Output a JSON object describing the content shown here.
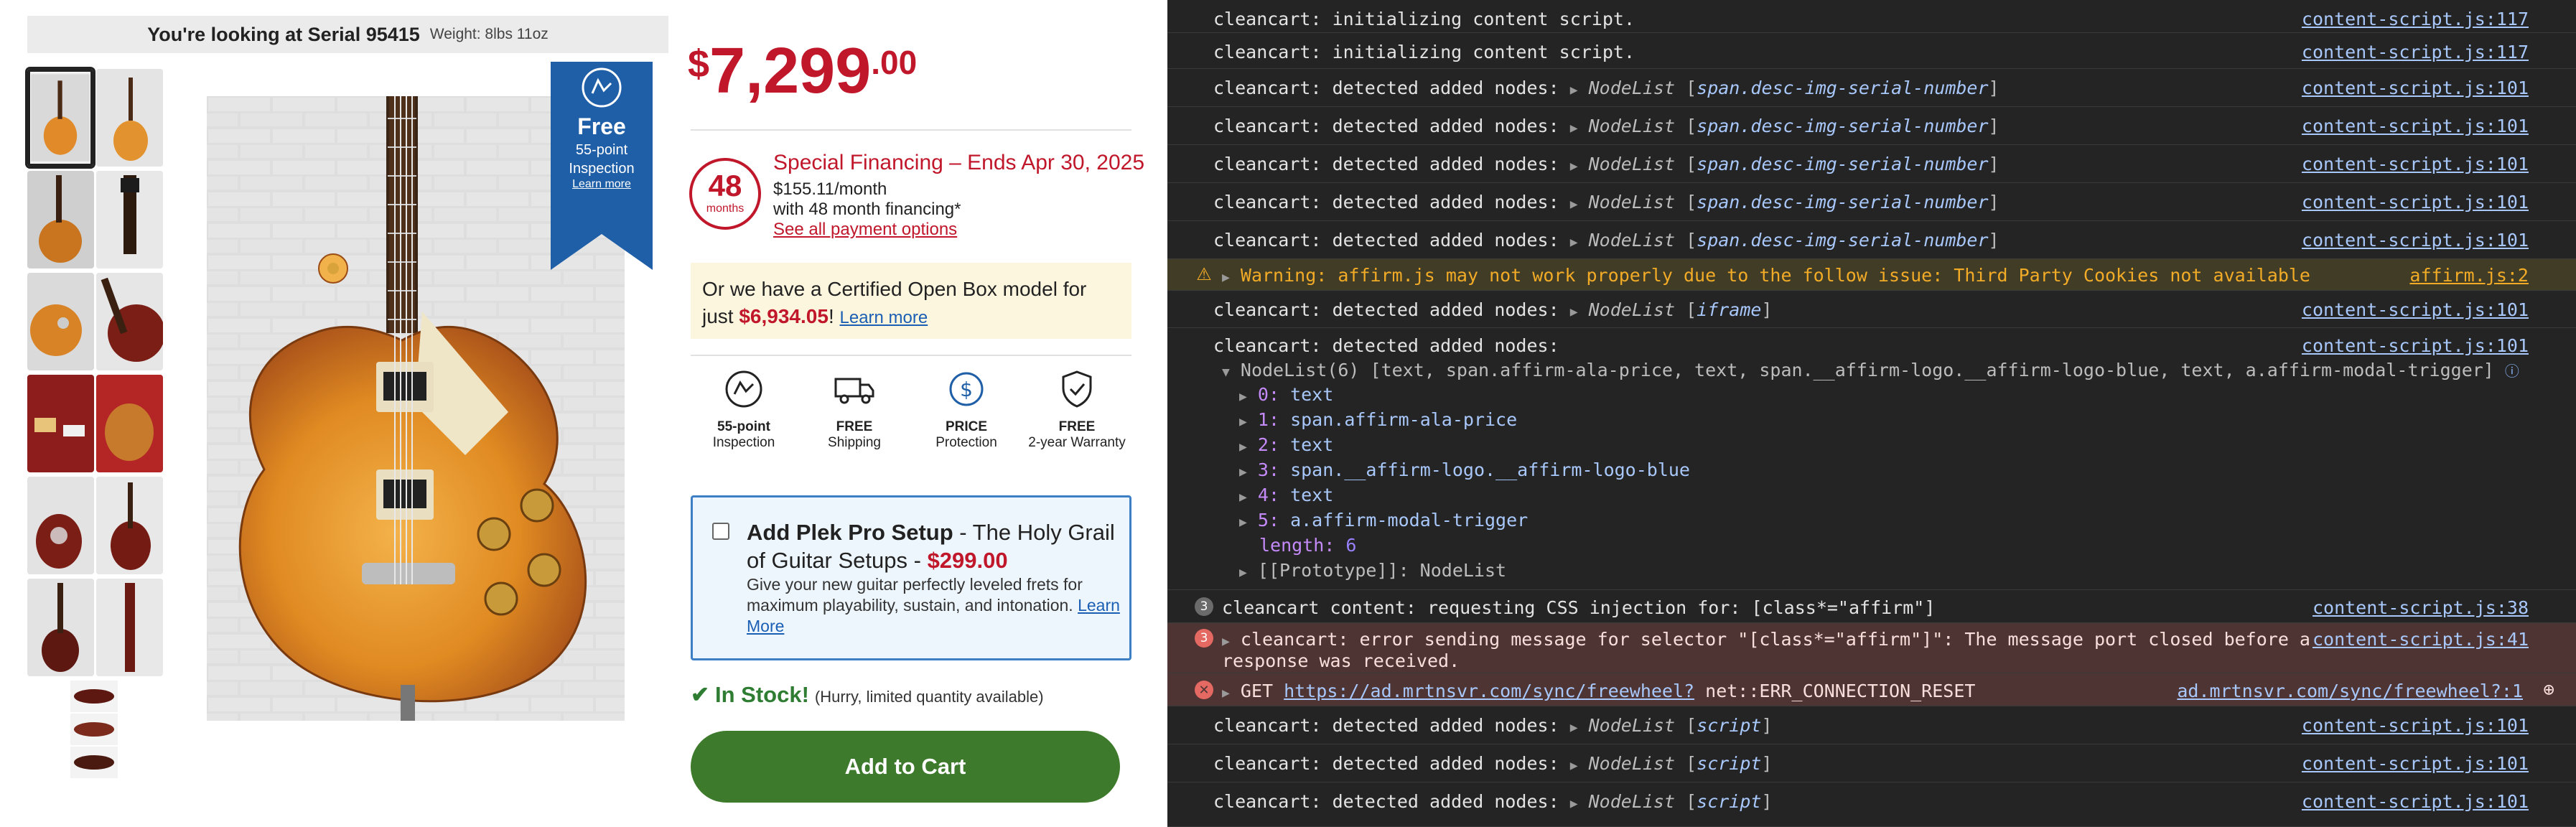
{
  "product": {
    "serial_label": "You're looking at Serial 95415",
    "weight": "Weight: 8lbs 11oz",
    "ribbon": {
      "title": "Free",
      "sub1": "55-point",
      "sub2": "Inspection",
      "link": "Learn more"
    },
    "price": {
      "currency": "$",
      "whole": "7,299",
      "cents": ".00"
    },
    "financing": {
      "months_num": "48",
      "months_label": "months",
      "title": "Special Financing",
      "ends": " – Ends Apr 30, 2025",
      "monthly": "$155.11/month",
      "with": "with 48 month financing*",
      "options_link": "See all payment options"
    },
    "open_box": {
      "text1": "Or we have a Certified Open Box model for just ",
      "price": "$6,934.05",
      "bang": "!",
      "link": "Learn more"
    },
    "features": [
      {
        "icon": "inspection-hand-icon",
        "bold": "55-point",
        "text": "Inspection"
      },
      {
        "icon": "truck-icon",
        "bold": "FREE",
        "text": "Shipping"
      },
      {
        "icon": "price-protection-icon",
        "bold": "PRICE",
        "text": "Protection"
      },
      {
        "icon": "shield-check-icon",
        "bold": "FREE",
        "text": "2-year Warranty"
      }
    ],
    "plek": {
      "title": "Add Plek Pro Setup",
      "mid": " - The Holy Grail of Guitar Setups - ",
      "price": "$299.00",
      "desc": "Give your new guitar perfectly leveled frets for maximum playability, sustain, and intonation. ",
      "link": "Learn More"
    },
    "stock": {
      "label": "In Stock!",
      "sub": "(Hurry, limited quantity available)"
    },
    "add_to_cart": "Add to Cart",
    "colors": {
      "price_red": "#c0172b",
      "cart_green": "#3d7a2b",
      "ribbon_blue": "#1f5fa8"
    }
  },
  "console": {
    "rows": [
      {
        "msg": "cleancart: initializing content script.",
        "src": "content-script.js:117"
      },
      {
        "msg": "cleancart: initializing content script.",
        "src": "content-script.js:117"
      },
      {
        "msg": "cleancart: detected added nodes: ",
        "node": "span.desc-img-serial-number",
        "src": "content-script.js:101"
      },
      {
        "msg": "cleancart: detected added nodes: ",
        "node": "span.desc-img-serial-number",
        "src": "content-script.js:101"
      },
      {
        "msg": "cleancart: detected added nodes: ",
        "node": "span.desc-img-serial-number",
        "src": "content-script.js:101"
      },
      {
        "msg": "cleancart: detected added nodes: ",
        "node": "span.desc-img-serial-number",
        "src": "content-script.js:101"
      },
      {
        "msg": "cleancart: detected added nodes: ",
        "node": "span.desc-img-serial-number",
        "src": "content-script.js:101"
      }
    ],
    "warning": {
      "msg": "Warning: affirm.js may not work properly due to the follow issue: Third Party Cookies not available",
      "src": "affirm.js:2"
    },
    "iframe_row": {
      "msg": "cleancart: detected added nodes: ",
      "node": "iframe",
      "src": "content-script.js:101"
    },
    "expanded": {
      "msg": "cleancart: detected added nodes:",
      "src": "content-script.js:101",
      "summary": "NodeList(6) [text, span.affirm-ala-price, text, span.__affirm-logo.__affirm-logo-blue, text, a.affirm-modal-trigger]",
      "items": [
        {
          "idx": "0:",
          "val": "text"
        },
        {
          "idx": "1:",
          "val": "span.affirm-ala-price"
        },
        {
          "idx": "2:",
          "val": "text"
        },
        {
          "idx": "3:",
          "val": "span.__affirm-logo.__affirm-logo-blue"
        },
        {
          "idx": "4:",
          "val": "text"
        },
        {
          "idx": "5:",
          "val": "a.affirm-modal-trigger"
        }
      ],
      "length_label": "length:",
      "length": "6",
      "proto": "[[Prototype]]: NodeList"
    },
    "css_row": {
      "count": "3",
      "msg": "cleancart content: requesting CSS injection for: [class*=\"affirm\"]",
      "src": "content-script.js:38"
    },
    "error_row": {
      "count": "3",
      "msg1": "cleancart: error sending message for selector \"[class*=\"affirm\"]\": The message port closed before a",
      "msg2": "response was received.",
      "src": "content-script.js:41"
    },
    "get_row": {
      "method": "GET",
      "url": "https://ad.mrtnsvr.com/sync/freewheel?",
      "err": "net::ERR_CONNECTION_RESET",
      "src": "ad.mrtnsvr.com/sync/freewheel?:1"
    },
    "script_rows": [
      {
        "msg": "cleancart: detected added nodes: ",
        "node": "script",
        "src": "content-script.js:101"
      },
      {
        "msg": "cleancart: detected added nodes: ",
        "node": "script",
        "src": "content-script.js:101"
      },
      {
        "msg": "cleancart: detected added nodes: ",
        "node": "script",
        "src": "content-script.js:101"
      }
    ],
    "colors": {
      "bg": "#242424",
      "link": "#a8c7fa",
      "warn": "#f2ab26",
      "error_bg": "#4e3534"
    }
  }
}
